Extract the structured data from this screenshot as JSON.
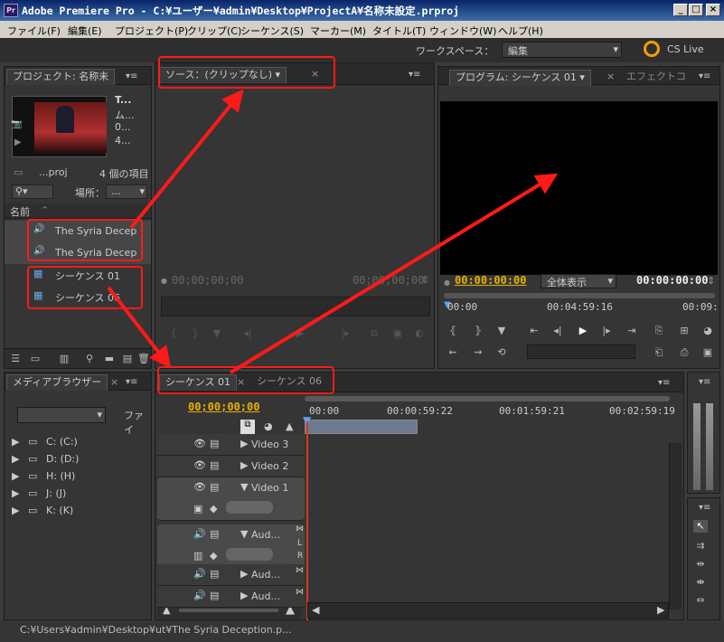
{
  "window": {
    "title": "Adobe Premiere Pro - C:¥ユーザー¥admin¥Desktop¥ProjectA¥名称未設定.prproj",
    "app_icon": "Pr",
    "controls": [
      "_",
      "□",
      "×"
    ]
  },
  "menu": [
    "ファイル(F)",
    "編集(E)",
    "プロジェクト(P)",
    "クリップ(C)",
    "シーケンス(S)",
    "マーカー(M)",
    "タイトル(T)",
    "ウィンドウ(W)",
    "ヘルプ(H)"
  ],
  "workspace": {
    "label": "ワークスペース：",
    "value": "編集",
    "cs_live": "CS Live"
  },
  "project": {
    "tab": "プロジェクト: 名称未",
    "thumb_info": [
      "T...",
      "ム...",
      "0...",
      "4..."
    ],
    "file": "...proj",
    "count": "4 個の項目",
    "location_label": "場所：",
    "location_value": "...",
    "column_name": "名前",
    "items": [
      {
        "label": "The Syria Decep",
        "type": "audio-clip"
      },
      {
        "label": "The Syria Decep",
        "type": "audio-clip"
      },
      {
        "label": "シーケンス 01",
        "type": "sequence"
      },
      {
        "label": "シーケンス 06",
        "type": "sequence"
      }
    ]
  },
  "source": {
    "tab": "ソース：(クリップなし)",
    "tc_left": "00;00;00;00",
    "tc_right": "00;00;00;00"
  },
  "program": {
    "tab": "プログラム: シーケンス 01",
    "tab2": "エフェクトコ",
    "tc_left": "00:00:00:00",
    "fit": "全体表示",
    "tc_right": "00:00:00:00",
    "ruler": [
      "00:00",
      "00:04:59:16",
      "00:09:"
    ]
  },
  "media_browser": {
    "tab": "メディアブラウザー",
    "filter_label": "ファイ",
    "drives": [
      "C: (C:)",
      "D: (D:)",
      "H: (H)",
      "J: (J)",
      "K: (K)"
    ]
  },
  "timeline": {
    "tabs": [
      "シーケンス 01",
      "シーケンス 06"
    ],
    "timecode": "00;00;00;00",
    "ruler": [
      "00:00",
      "00:00:59:22",
      "00:01:59:21",
      "00:02:59:19"
    ],
    "tracks": [
      "Video 3",
      "Video 2",
      "Video 1",
      "Aud...",
      "Aud...",
      "Aud..."
    ],
    "channels": [
      "L",
      "R"
    ]
  },
  "statusbar": "C:¥Users¥admin¥Desktop¥ut¥The Syria Deception.p...",
  "colors": {
    "accent_timecode": "#e7b100",
    "annotation": "#ff1a1a",
    "playhead": "#d43c1a"
  }
}
